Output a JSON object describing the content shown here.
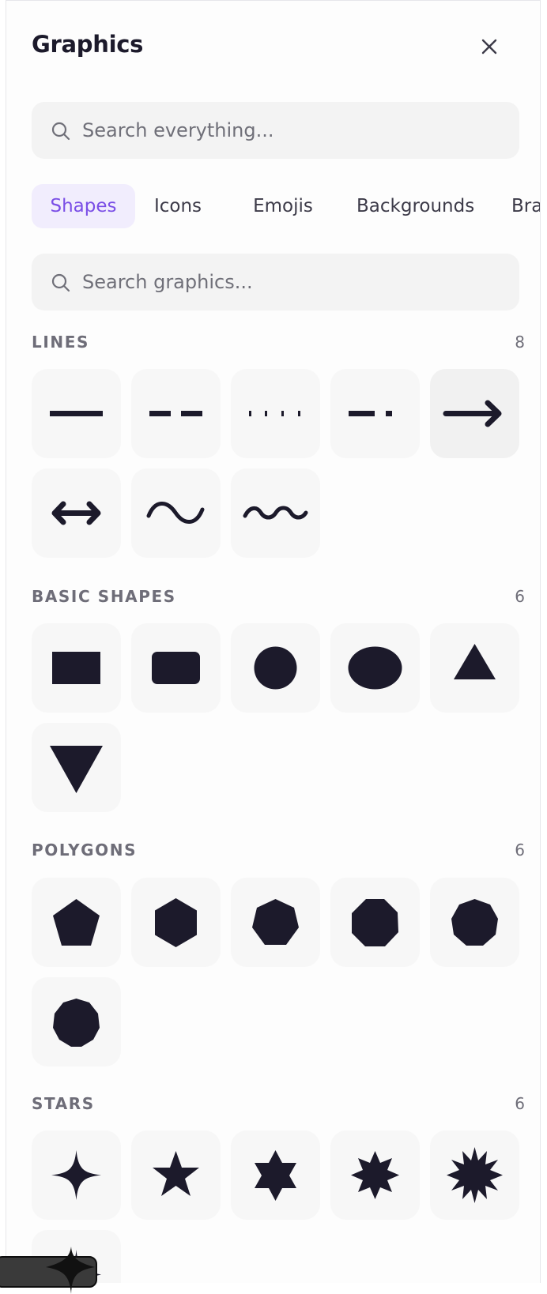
{
  "panel": {
    "title": "Graphics"
  },
  "global_search": {
    "placeholder": "Search everything..."
  },
  "tabs": [
    {
      "label": "Shapes",
      "active": true
    },
    {
      "label": "Icons",
      "active": false
    },
    {
      "label": "Emojis",
      "active": false
    },
    {
      "label": "Backgrounds",
      "active": false
    },
    {
      "label": "Brands",
      "active": false
    }
  ],
  "graphics_search": {
    "placeholder": "Search graphics..."
  },
  "sections": {
    "lines": {
      "label": "LINES",
      "count": "8",
      "items": [
        "solid-line-icon",
        "dashed-line-icon",
        "dotted-line-icon",
        "dash-dot-line-icon",
        "arrow-right-icon",
        "double-arrow-icon",
        "wave-line-icon",
        "small-wave-line-icon"
      ]
    },
    "basic_shapes": {
      "label": "BASIC SHAPES",
      "count": "6",
      "items": [
        "rectangle-icon",
        "rounded-rectangle-icon",
        "circle-icon",
        "ellipse-icon",
        "triangle-icon",
        "inverted-triangle-icon"
      ]
    },
    "polygons": {
      "label": "POLYGONS",
      "count": "6",
      "items": [
        "pentagon-icon",
        "hexagon-icon",
        "heptagon-icon",
        "octagon-icon",
        "nonagon-icon",
        "decagon-icon"
      ]
    },
    "stars": {
      "label": "STARS",
      "count": "6",
      "items": [
        "four-point-star-icon",
        "five-point-star-icon",
        "six-point-star-icon",
        "eight-point-star-icon",
        "twelve-point-star-icon",
        "sparkle-star-icon"
      ]
    }
  },
  "colors": {
    "accent": "#7a4ee6",
    "accent_bg": "#f1edfd",
    "shape_fill": "#1c1a2b",
    "tile_bg": "#f7f7f7",
    "search_bg": "#f3f3f3"
  }
}
